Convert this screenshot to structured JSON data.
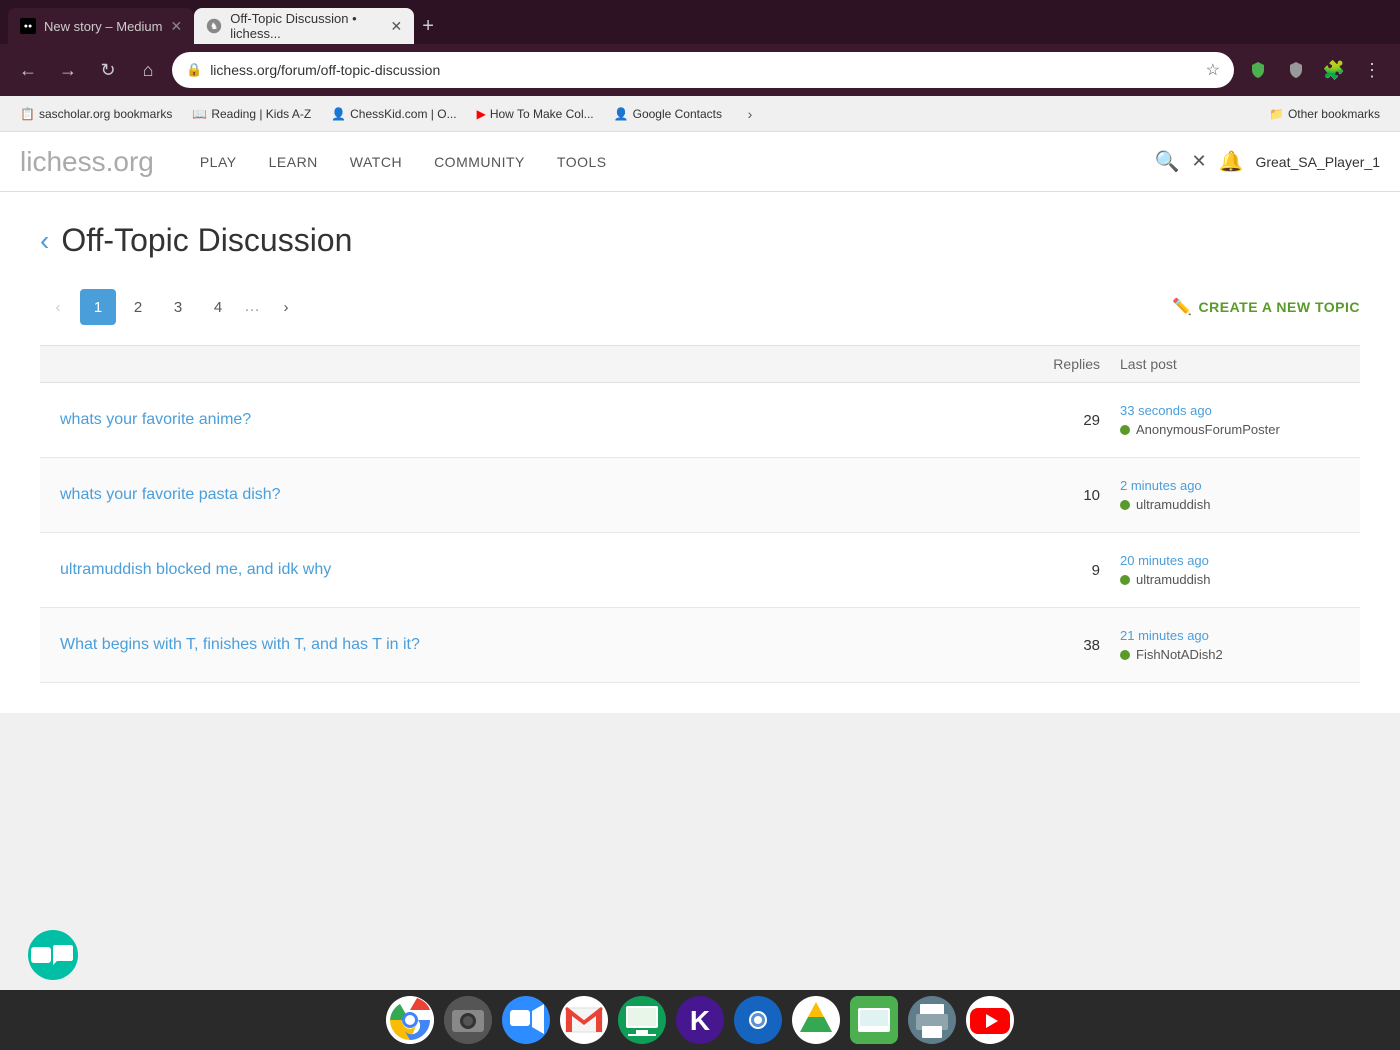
{
  "browser": {
    "tabs": [
      {
        "id": "tab1",
        "title": "New story – Medium",
        "favicon": "medium",
        "active": false
      },
      {
        "id": "tab2",
        "title": "Off-Topic Discussion • lichess...",
        "favicon": "lichess",
        "active": true
      }
    ],
    "url": "lichess.org/forum/off-topic-discussion",
    "bookmarks": [
      {
        "label": "sascholar.org bookmarks",
        "icon": "📋"
      },
      {
        "label": "Reading | Kids A-Z",
        "icon": "📖"
      },
      {
        "label": "ChessKid.com | O...",
        "icon": "👤"
      },
      {
        "label": "How To Make Col...",
        "icon": "▶"
      },
      {
        "label": "Google Contacts",
        "icon": "👤"
      }
    ],
    "other_bookmarks_label": "Other bookmarks"
  },
  "lichess": {
    "logo_main": "lichess",
    "logo_suffix": ".org",
    "nav": {
      "items": [
        {
          "id": "play",
          "label": "PLAY"
        },
        {
          "id": "learn",
          "label": "LEARN"
        },
        {
          "id": "watch",
          "label": "WATCH"
        },
        {
          "id": "community",
          "label": "COMMUNITY"
        },
        {
          "id": "tools",
          "label": "TOOLS"
        }
      ]
    },
    "username": "Great_SA_Player_1",
    "back_label": "‹",
    "page_title": "Off-Topic Discussion",
    "pagination": {
      "prev_label": "‹",
      "next_label": "›",
      "pages": [
        "1",
        "2",
        "3",
        "4"
      ],
      "current": "1",
      "dots": "…"
    },
    "create_topic_label": "CREATE A NEW TOPIC",
    "table_headers": {
      "replies": "Replies",
      "last_post": "Last post"
    },
    "topics": [
      {
        "title": "whats your favorite anime?",
        "replies": "29",
        "last_post_time": "33 seconds ago",
        "last_post_user": "AnonymousForumPoster",
        "online": true
      },
      {
        "title": "whats your favorite pasta dish?",
        "replies": "10",
        "last_post_time": "2 minutes ago",
        "last_post_user": "ultramuddish",
        "online": true
      },
      {
        "title": "ultramuddish blocked me, and idk why",
        "replies": "9",
        "last_post_time": "20 minutes ago",
        "last_post_user": "ultramuddish",
        "online": true
      },
      {
        "title": "What begins with T, finishes with T, and has T in it?",
        "replies": "38",
        "last_post_time": "21 minutes ago",
        "last_post_user": "FishNotADish2",
        "online": true
      }
    ]
  },
  "taskbar": {
    "icons": [
      {
        "name": "chrome",
        "label": "Google Chrome"
      },
      {
        "name": "camera",
        "label": "Camera"
      },
      {
        "name": "zoom",
        "label": "Zoom"
      },
      {
        "name": "gmail",
        "label": "Gmail"
      },
      {
        "name": "classroom",
        "label": "Google Classroom"
      },
      {
        "name": "kahoot",
        "label": "Kahoot"
      },
      {
        "name": "system-prefs",
        "label": "System Preferences"
      },
      {
        "name": "drive",
        "label": "Google Drive"
      },
      {
        "name": "chrome2",
        "label": "Chrome App"
      },
      {
        "name": "print",
        "label": "Print"
      },
      {
        "name": "youtube",
        "label": "YouTube"
      }
    ]
  }
}
